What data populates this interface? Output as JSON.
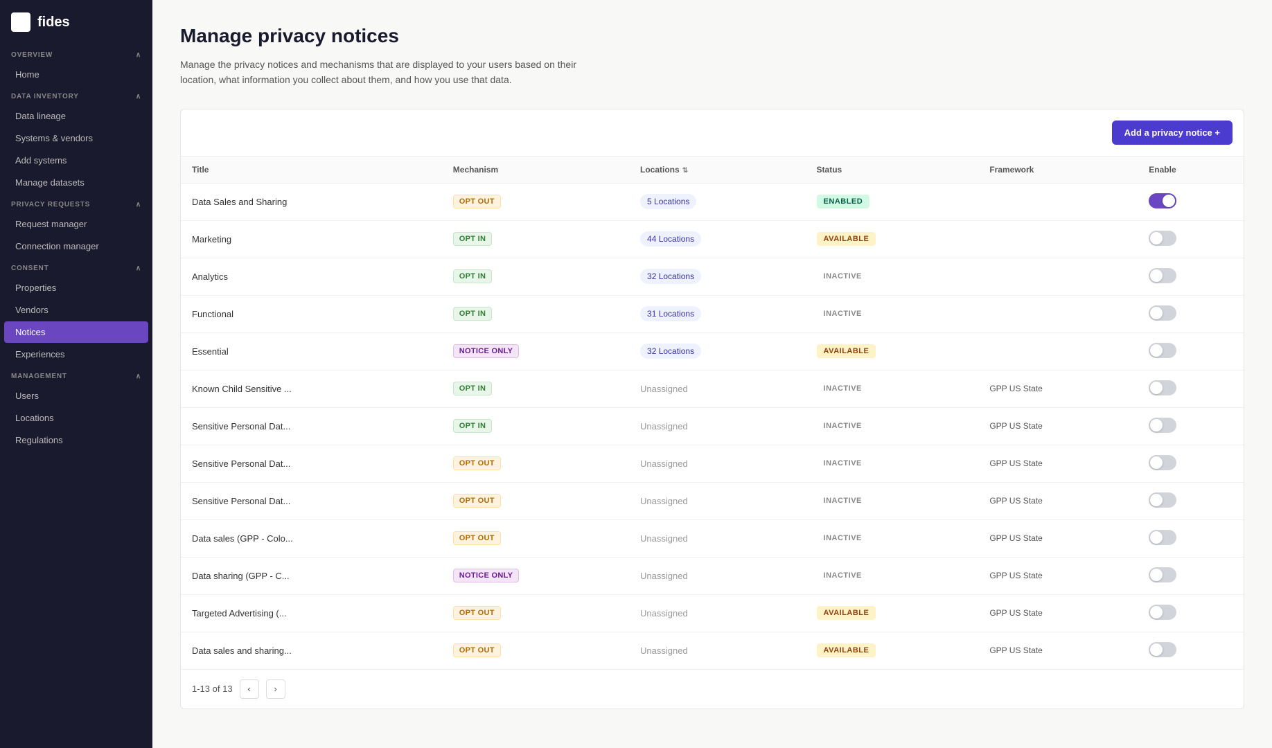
{
  "sidebar": {
    "logo": "fides",
    "sections": [
      {
        "label": "OVERVIEW",
        "items": [
          {
            "id": "home",
            "label": "Home",
            "active": false
          }
        ]
      },
      {
        "label": "DATA INVENTORY",
        "items": [
          {
            "id": "data-lineage",
            "label": "Data lineage",
            "active": false
          },
          {
            "id": "systems-vendors",
            "label": "Systems & vendors",
            "active": false
          },
          {
            "id": "add-systems",
            "label": "Add systems",
            "active": false
          },
          {
            "id": "manage-datasets",
            "label": "Manage datasets",
            "active": false
          }
        ]
      },
      {
        "label": "PRIVACY REQUESTS",
        "items": [
          {
            "id": "request-manager",
            "label": "Request manager",
            "active": false
          },
          {
            "id": "connection-manager",
            "label": "Connection manager",
            "active": false
          }
        ]
      },
      {
        "label": "CONSENT",
        "items": [
          {
            "id": "properties",
            "label": "Properties",
            "active": false
          },
          {
            "id": "vendors",
            "label": "Vendors",
            "active": false
          },
          {
            "id": "notices",
            "label": "Notices",
            "active": true
          },
          {
            "id": "experiences",
            "label": "Experiences",
            "active": false
          }
        ]
      },
      {
        "label": "MANAGEMENT",
        "items": [
          {
            "id": "users",
            "label": "Users",
            "active": false
          },
          {
            "id": "locations",
            "label": "Locations",
            "active": false
          },
          {
            "id": "regulations",
            "label": "Regulations",
            "active": false
          }
        ]
      }
    ]
  },
  "page": {
    "title": "Manage privacy notices",
    "description": "Manage the privacy notices and mechanisms that are displayed to your users based on their location, what information you collect about them, and how you use that data.",
    "add_button_label": "Add a privacy notice +"
  },
  "table": {
    "columns": [
      {
        "id": "title",
        "label": "Title"
      },
      {
        "id": "mechanism",
        "label": "Mechanism"
      },
      {
        "id": "locations",
        "label": "Locations",
        "sortable": true
      },
      {
        "id": "status",
        "label": "Status"
      },
      {
        "id": "framework",
        "label": "Framework"
      },
      {
        "id": "enable",
        "label": "Enable"
      }
    ],
    "rows": [
      {
        "title": "Data Sales and Sharing",
        "mechanism": "OPT OUT",
        "mechanism_type": "opt-out",
        "locations": "5 Locations",
        "loc_type": "badge",
        "status": "ENABLED",
        "status_type": "enabled",
        "framework": "",
        "enabled": true
      },
      {
        "title": "Marketing",
        "mechanism": "OPT IN",
        "mechanism_type": "opt-in",
        "locations": "44 Locations",
        "loc_type": "badge",
        "status": "AVAILABLE",
        "status_type": "available",
        "framework": "",
        "enabled": false
      },
      {
        "title": "Analytics",
        "mechanism": "OPT IN",
        "mechanism_type": "opt-in",
        "locations": "32 Locations",
        "loc_type": "badge",
        "status": "INACTIVE",
        "status_type": "inactive",
        "framework": "",
        "enabled": false
      },
      {
        "title": "Functional",
        "mechanism": "OPT IN",
        "mechanism_type": "opt-in",
        "locations": "31 Locations",
        "loc_type": "badge",
        "status": "INACTIVE",
        "status_type": "inactive",
        "framework": "",
        "enabled": false
      },
      {
        "title": "Essential",
        "mechanism": "NOTICE ONLY",
        "mechanism_type": "notice",
        "locations": "32 Locations",
        "loc_type": "badge",
        "status": "AVAILABLE",
        "status_type": "available",
        "framework": "",
        "enabled": false
      },
      {
        "title": "Known Child Sensitive ...",
        "mechanism": "OPT IN",
        "mechanism_type": "opt-in",
        "locations": "Unassigned",
        "loc_type": "text",
        "status": "INACTIVE",
        "status_type": "inactive",
        "framework": "GPP US State",
        "enabled": false
      },
      {
        "title": "Sensitive Personal Dat...",
        "mechanism": "OPT IN",
        "mechanism_type": "opt-in",
        "locations": "Unassigned",
        "loc_type": "text",
        "status": "INACTIVE",
        "status_type": "inactive",
        "framework": "GPP US State",
        "enabled": false
      },
      {
        "title": "Sensitive Personal Dat...",
        "mechanism": "OPT OUT",
        "mechanism_type": "opt-out",
        "locations": "Unassigned",
        "loc_type": "text",
        "status": "INACTIVE",
        "status_type": "inactive",
        "framework": "GPP US State",
        "enabled": false
      },
      {
        "title": "Sensitive Personal Dat...",
        "mechanism": "OPT OUT",
        "mechanism_type": "opt-out",
        "locations": "Unassigned",
        "loc_type": "text",
        "status": "INACTIVE",
        "status_type": "inactive",
        "framework": "GPP US State",
        "enabled": false
      },
      {
        "title": "Data sales (GPP - Colo...",
        "mechanism": "OPT OUT",
        "mechanism_type": "opt-out",
        "locations": "Unassigned",
        "loc_type": "text",
        "status": "INACTIVE",
        "status_type": "inactive",
        "framework": "GPP US State",
        "enabled": false
      },
      {
        "title": "Data sharing (GPP - C...",
        "mechanism": "NOTICE ONLY",
        "mechanism_type": "notice",
        "locations": "Unassigned",
        "loc_type": "text",
        "status": "INACTIVE",
        "status_type": "inactive",
        "framework": "GPP US State",
        "enabled": false
      },
      {
        "title": "Targeted Advertising (...",
        "mechanism": "OPT OUT",
        "mechanism_type": "opt-out",
        "locations": "Unassigned",
        "loc_type": "text",
        "status": "AVAILABLE",
        "status_type": "available",
        "framework": "GPP US State",
        "enabled": false
      },
      {
        "title": "Data sales and sharing...",
        "mechanism": "OPT OUT",
        "mechanism_type": "opt-out",
        "locations": "Unassigned",
        "loc_type": "text",
        "status": "AVAILABLE",
        "status_type": "available",
        "framework": "GPP US State",
        "enabled": false
      }
    ],
    "pagination": {
      "label": "1-13 of 13"
    }
  }
}
